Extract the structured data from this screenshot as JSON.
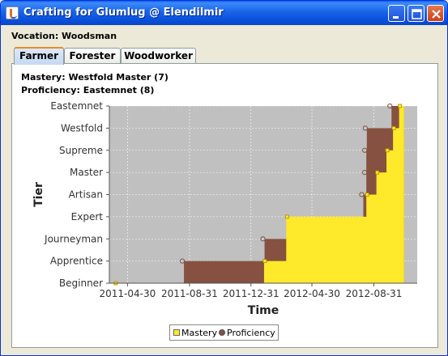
{
  "window": {
    "title": "Crafting for Glumlug @ Elendilmir",
    "buttons": [
      "minimize",
      "maximize",
      "close"
    ]
  },
  "vocation_label": "Vocation: Woodsman",
  "tabs": [
    {
      "label": "Farmer",
      "selected": true
    },
    {
      "label": "Forester",
      "selected": false
    },
    {
      "label": "Woodworker",
      "selected": false
    }
  ],
  "panel": {
    "mastery": "Mastery: Westfold Master (7)",
    "proficiency": "Proficiency: Eastemnet (8)"
  },
  "colors": {
    "mastery": "#ffe92a",
    "proficiency": "#865140",
    "plot_background": "#c0c0c0",
    "tab_highlight": "#e68b2c",
    "titlebar": "#0a52de"
  },
  "chart_data": {
    "type": "area",
    "title": "",
    "xlabel": "Time",
    "ylabel": "Tier",
    "x_ticks": [
      "2011-04-30",
      "2011-08-31",
      "2011-12-31",
      "2012-04-30",
      "2012-08-31"
    ],
    "x_range": [
      "2011-03-25",
      "2012-11-25"
    ],
    "y_categories": [
      "Beginner",
      "Apprentice",
      "Journeyman",
      "Expert",
      "Artisan",
      "Master",
      "Supreme",
      "Westfold",
      "Eastemnet"
    ],
    "y_range": [
      0,
      8
    ],
    "grid": true,
    "legend": {
      "placement": "bottom",
      "entries": [
        "Mastery",
        "Proficiency"
      ]
    },
    "series": [
      {
        "name": "Mastery",
        "points": [
          {
            "date": "2011-04-05",
            "tier": 0
          },
          {
            "date": "2012-01-26",
            "tier": 1
          },
          {
            "date": "2012-03-10",
            "tier": 3
          },
          {
            "date": "2012-08-16",
            "tier": 4
          },
          {
            "date": "2012-09-05",
            "tier": 5
          },
          {
            "date": "2012-09-25",
            "tier": 6
          },
          {
            "date": "2012-10-08",
            "tier": 7
          },
          {
            "date": "2012-10-20",
            "tier": 8
          }
        ]
      },
      {
        "name": "Proficiency",
        "points": [
          {
            "date": "2011-08-20",
            "tier": 1
          },
          {
            "date": "2012-01-27",
            "tier": 2
          },
          {
            "date": "2012-08-10",
            "tier": 4
          },
          {
            "date": "2012-08-16",
            "tier": 5
          },
          {
            "date": "2012-08-16",
            "tier": 6
          },
          {
            "date": "2012-08-17",
            "tier": 7
          },
          {
            "date": "2012-10-05",
            "tier": 8
          }
        ]
      }
    ]
  }
}
